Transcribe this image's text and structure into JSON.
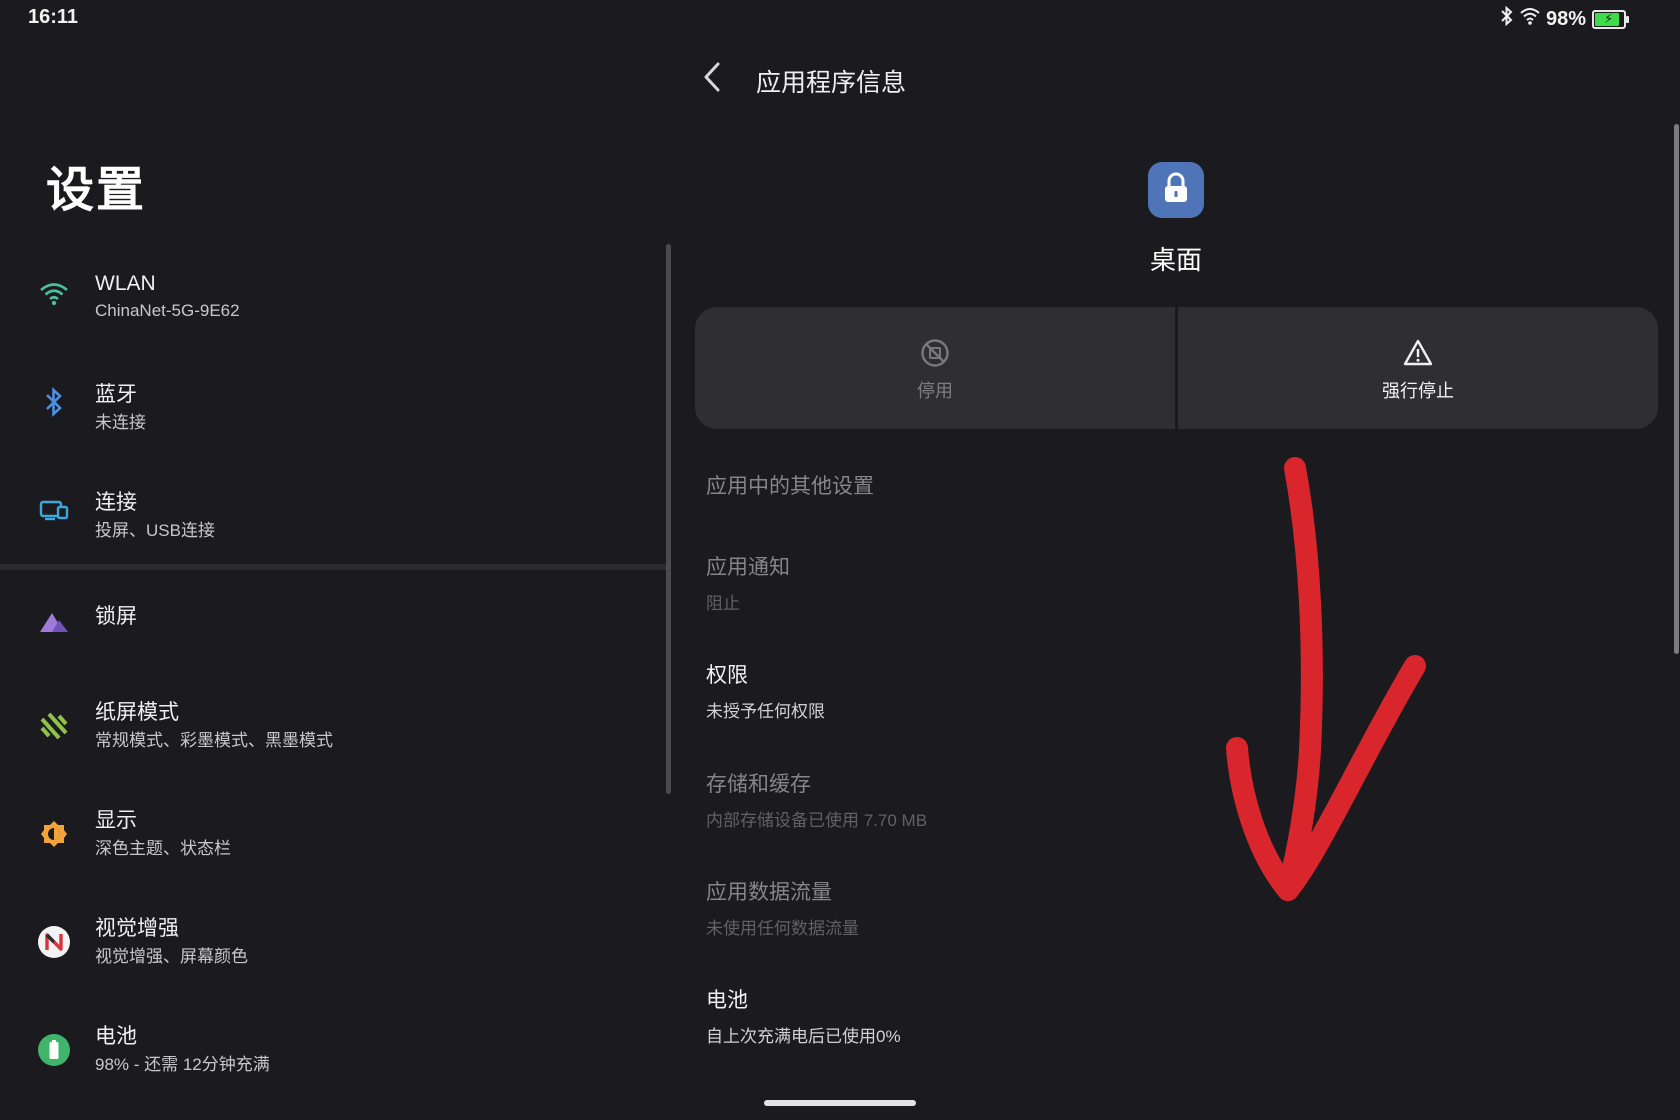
{
  "status_bar": {
    "time": "16:11",
    "battery_percent": "98%",
    "icons": [
      "bluetooth-icon",
      "wifi-icon",
      "battery-icon"
    ]
  },
  "settings": {
    "title": "设置",
    "items": [
      {
        "label": "WLAN",
        "sub": "ChinaNet-5G-9E62",
        "icon": "wifi-icon"
      },
      {
        "label": "蓝牙",
        "sub": "未连接",
        "icon": "bluetooth-icon"
      },
      {
        "label": "连接",
        "sub": "投屏、USB连接",
        "icon": "devices-icon"
      },
      {
        "label": "锁屏",
        "sub": "",
        "icon": "lockscreen-icon"
      },
      {
        "label": "纸屏模式",
        "sub": "常规模式、彩墨模式、黑墨模式",
        "icon": "paper-mode-icon"
      },
      {
        "label": "显示",
        "sub": "深色主题、状态栏",
        "icon": "display-icon"
      },
      {
        "label": "视觉增强",
        "sub": "视觉增强、屏幕颜色",
        "icon": "visual-enhance-icon"
      },
      {
        "label": "电池",
        "sub": "98% - 还需 12分钟充满",
        "icon": "battery-icon"
      }
    ]
  },
  "app_info": {
    "page_title": "应用程序信息",
    "app_name": "桌面",
    "app_icon": "lock-icon",
    "actions": [
      {
        "label": "停用",
        "icon": "disable-icon",
        "enabled": false
      },
      {
        "label": "强行停止",
        "icon": "warning-icon",
        "enabled": true
      }
    ],
    "prefs": [
      {
        "title": "应用中的其他设置",
        "sub": "",
        "enabled": false
      },
      {
        "title": "应用通知",
        "sub": "阻止",
        "enabled": false
      },
      {
        "title": "权限",
        "sub": "未授予任何权限",
        "enabled": true
      },
      {
        "title": "存储和缓存",
        "sub": "内部存储设备已使用 7.70 MB",
        "enabled": false
      },
      {
        "title": "应用数据流量",
        "sub": "未使用任何数据流量",
        "enabled": false
      },
      {
        "title": "电池",
        "sub": "自上次充满电后已使用0%",
        "enabled": true
      }
    ]
  },
  "colors": {
    "background": "#1b1b1f",
    "card": "#2f2f33",
    "annotation_arrow": "#d9262c",
    "app_icon_bg": "#4f74b8"
  }
}
